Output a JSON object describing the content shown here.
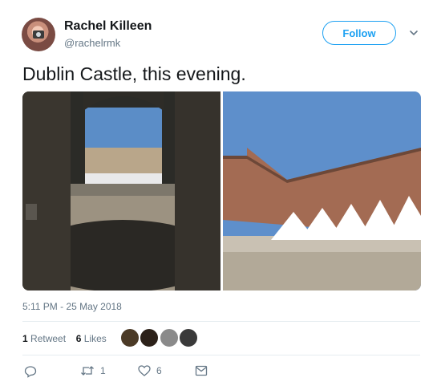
{
  "user": {
    "display_name": "Rachel Killeen",
    "handle": "@rachelrmk"
  },
  "follow_button": {
    "label": "Follow"
  },
  "tweet": {
    "text": "Dublin Castle, this evening."
  },
  "timestamp": "5:11 PM - 25 May 2018",
  "stats": {
    "retweets_count": "1",
    "retweets_label": "Retweet",
    "likes_count": "6",
    "likes_label": "Likes"
  },
  "actions": {
    "retweet_count": "1",
    "like_count": "6"
  },
  "colors": {
    "accent": "#1da1f2",
    "secondary_text": "#657786",
    "divider": "#e6ecf0"
  },
  "icons": {
    "reply": "reply-icon",
    "retweet": "retweet-icon",
    "like": "heart-icon",
    "message": "direct-message-icon",
    "more": "chevron-down-icon"
  }
}
